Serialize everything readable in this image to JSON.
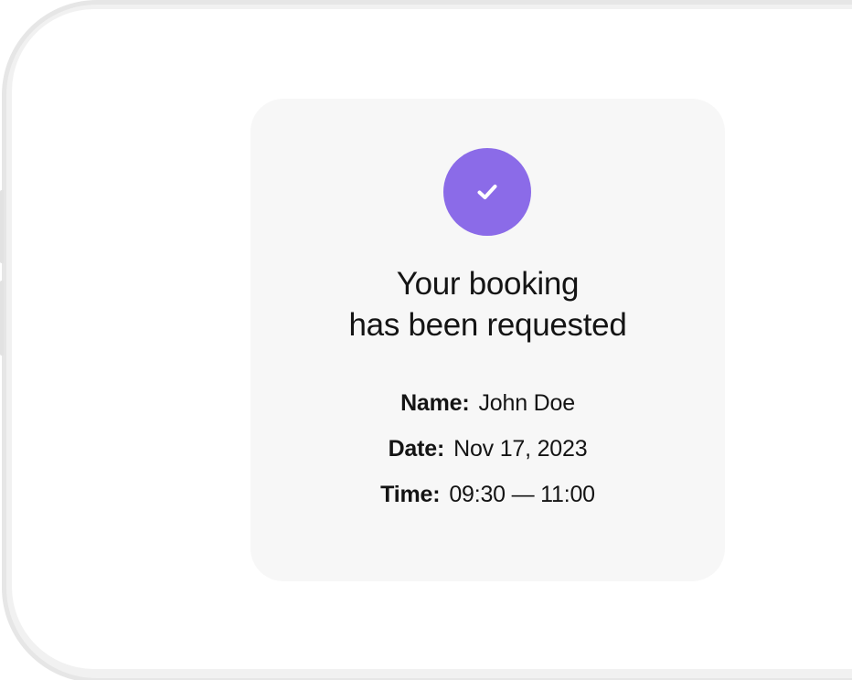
{
  "booking": {
    "title_line1": "Your booking",
    "title_line2": "has been requested",
    "status_icon": "checkmark-icon",
    "details": [
      {
        "label": "Name:",
        "value": "John Doe"
      },
      {
        "label": "Date:",
        "value": "Nov 17, 2023"
      },
      {
        "label": "Time:",
        "value": "09:30 — 11:00"
      }
    ]
  },
  "colors": {
    "accent": "#8b6be8",
    "card_background": "#f7f7f7",
    "text": "#141414"
  }
}
